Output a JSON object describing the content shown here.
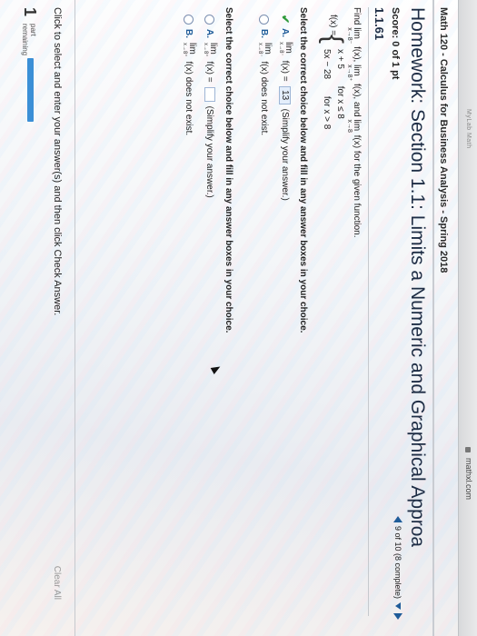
{
  "browser": {
    "url": "mathxl.com",
    "menu_hint": "MyLab Math"
  },
  "course_title": "Math 120 - Calculus for Business Analysis - Spring 2018",
  "homework_title": "Homework: Section 1.1: Limits a Numeric and Graphical Approa",
  "score": "Score: 0 of 1 pt",
  "pager": {
    "label": "9 of 10 (8 complete)"
  },
  "question_number": "1.1.61",
  "prompt": {
    "find": "Find",
    "lim": "lim",
    "sub_left": "x→8⁻",
    "sub_right": "x→8⁺",
    "sub": "x→8",
    "fx": "f(x),",
    "fx_and": "f(x), and",
    "fx_end": "f(x) for the given function."
  },
  "function": {
    "lhs": "f(x) =",
    "row1_expr": "x + 5",
    "row1_cond": "for x ≤ 8",
    "row2_expr": "5x − 28",
    "row2_cond": "for x > 8"
  },
  "instruction_1": "Select the correct choice below and fill in any answer boxes in your choice.",
  "part1_choices": {
    "a_letter": "A.",
    "a_lim": "lim",
    "a_sub": "x→8⁻",
    "a_fx": "f(x) =",
    "a_value": "13",
    "a_hint": "(Simplify your answer.)",
    "b_letter": "B.",
    "b_lim": "lim",
    "b_sub": "x→8⁻",
    "b_text": "f(x) does not exist."
  },
  "instruction_2": "Select the correct choice below and fill in any answer boxes in your choice.",
  "part2_choices": {
    "a_letter": "A.",
    "a_lim": "lim",
    "a_sub": "x→8⁺",
    "a_fx": "f(x) =",
    "a_hint": "(Simplify your answer.)",
    "b_letter": "B.",
    "b_lim": "lim",
    "b_sub": "x→8⁺",
    "b_text": "f(x) does not exist."
  },
  "click_instruction": "Click to select and enter your answer(s) and then click Check Answer.",
  "clear_all": "Clear All",
  "footer": {
    "parts_number": "1",
    "parts_line1": "part",
    "parts_line2": "remaining"
  },
  "colors": {
    "accent": "#1f5c99",
    "title": "#1e2d45",
    "progress": "#3b8fd6",
    "check": "#2f9a3a"
  }
}
